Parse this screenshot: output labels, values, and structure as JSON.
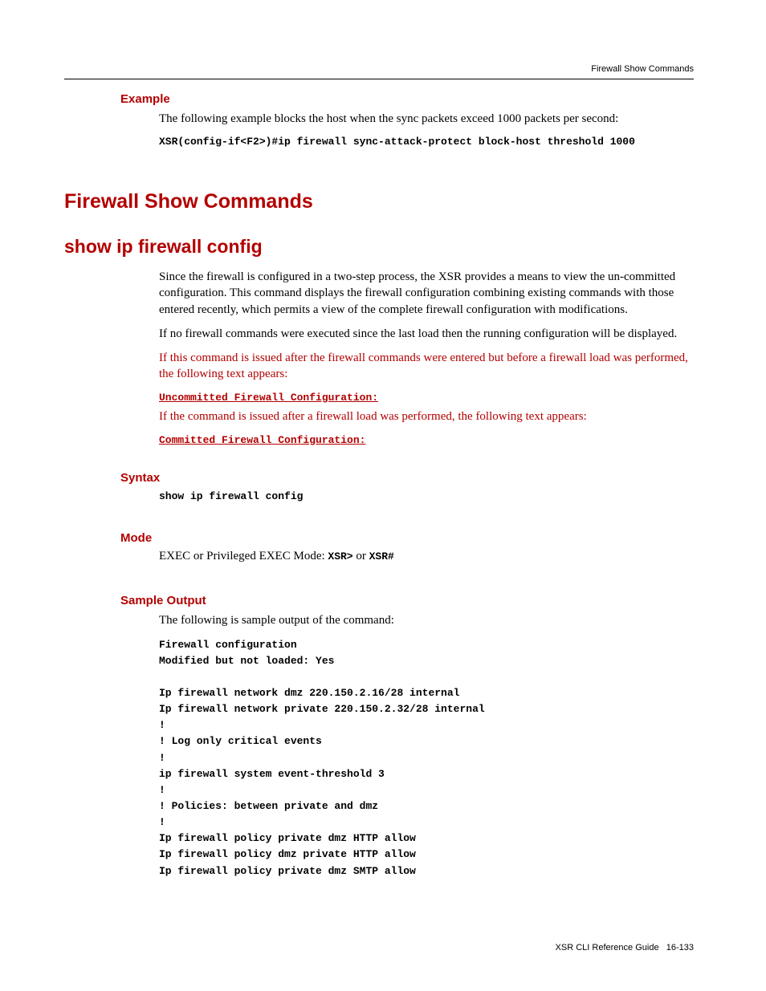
{
  "header": {
    "running": "Firewall Show Commands"
  },
  "example": {
    "heading": "Example",
    "intro": "The following example blocks the host when the sync packets exceed 1000 packets per second:",
    "code": "XSR(config-if<F2>)#ip firewall sync-attack-protect block-host threshold 1000"
  },
  "h1": "Firewall Show Commands",
  "h2": "show ip firewall config",
  "desc": {
    "p1": "Since the firewall is configured in a two-step process, the XSR provides a means to view the un-committed configuration. This command displays the firewall configuration combining existing commands with those entered recently, which permits a view of the complete firewall configuration with modifications.",
    "p2": "If no firewall commands were executed since the last load then the running configuration will be displayed.",
    "p3_red": "If this command is issued after the firewall commands were entered but before a firewall load was performed, the following text appears:",
    "code1_red": "Uncommitted Firewall Configuration:",
    "p4_red": "If the command is issued after a firewall load was performed, the following text appears:",
    "code2_red": "Committed Firewall Configuration:"
  },
  "syntax": {
    "heading": "Syntax",
    "code": "show ip firewall config"
  },
  "mode": {
    "heading": "Mode",
    "text_prefix": "EXEC or Privileged EXEC Mode: ",
    "code1": "XSR>",
    "text_mid": " or ",
    "code2": "XSR#"
  },
  "sample": {
    "heading": "Sample Output",
    "intro": "The following is sample output of the command:",
    "output": "Firewall configuration\nModified but not loaded: Yes\n\nIp firewall network dmz 220.150.2.16/28 internal\nIp firewall network private 220.150.2.32/28 internal\n!\n! Log only critical events\n!\nip firewall system event-threshold 3\n!\n! Policies: between private and dmz\n!\nIp firewall policy private dmz HTTP allow\nIp firewall policy dmz private HTTP allow\nIp firewall policy private dmz SMTP allow"
  },
  "footer": {
    "book": "XSR CLI Reference Guide",
    "page": "16-133"
  }
}
